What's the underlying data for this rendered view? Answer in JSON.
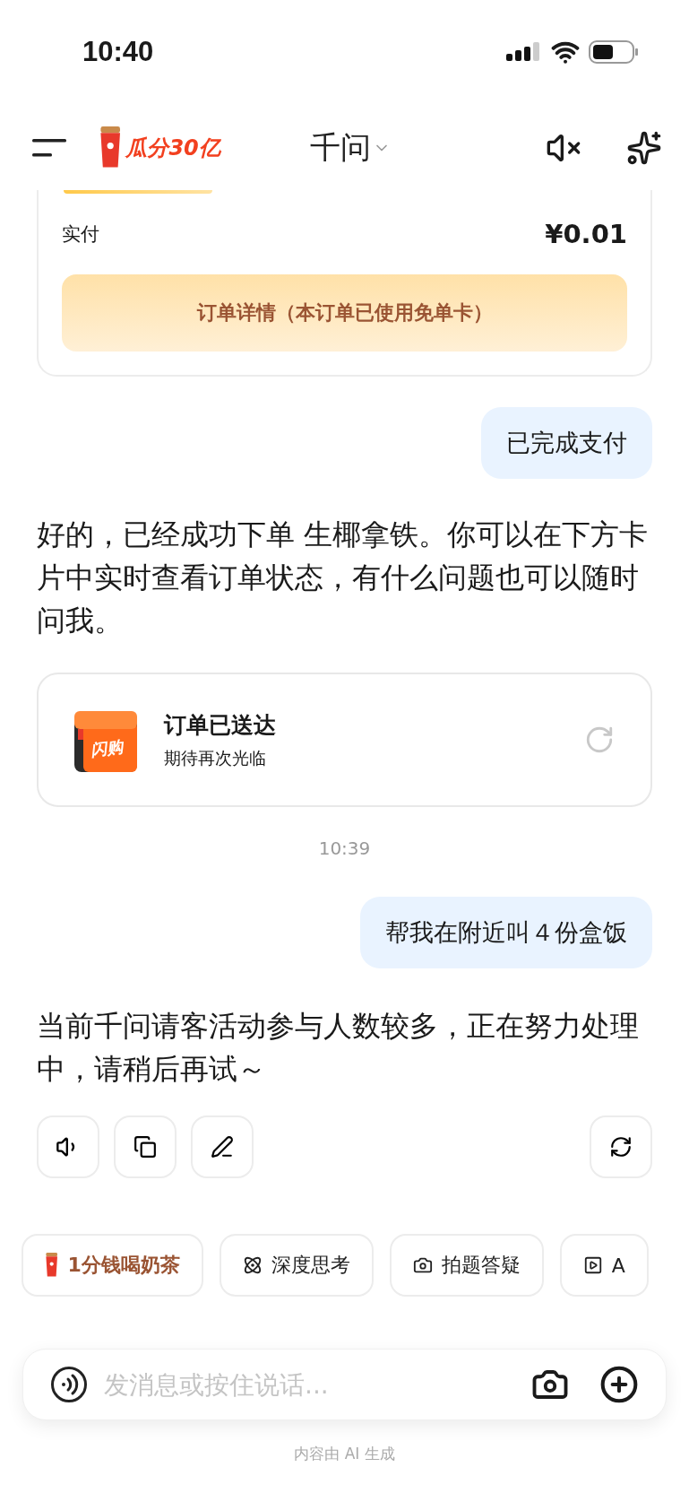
{
  "status_bar": {
    "time": "10:40"
  },
  "header": {
    "promo": "瓜分30亿",
    "title": "千问",
    "muted": true
  },
  "payment_card": {
    "label": "实付",
    "amount": "¥0.01",
    "button": "订单详情（本订单已使用免单卡）"
  },
  "messages": [
    {
      "kind": "user",
      "text": "已完成支付"
    },
    {
      "kind": "assistant",
      "text": "好的，已经成功下单 生椰拿铁。你可以在下方卡片中实时查看订单状态，有什么问题也可以随时问我。"
    },
    {
      "kind": "order",
      "title": "订单已送达",
      "subtitle": "期待再次光临",
      "badge": "闪购"
    },
    {
      "kind": "time",
      "text": "10:39"
    },
    {
      "kind": "user",
      "text": "帮我在附近叫４份盒饭"
    },
    {
      "kind": "assistant",
      "text": "当前千问请客活动参与人数较多，正在努力处理中，请稍后再试～"
    }
  ],
  "chips": [
    {
      "kind": "promo",
      "label": "1分钱喝奶茶"
    },
    {
      "kind": "think",
      "label": "深度思考"
    },
    {
      "kind": "photo",
      "label": "拍题答疑"
    },
    {
      "kind": "video",
      "label": "A"
    }
  ],
  "input": {
    "placeholder": "发消息或按住说话..."
  },
  "footer": "内容由 AI 生成"
}
